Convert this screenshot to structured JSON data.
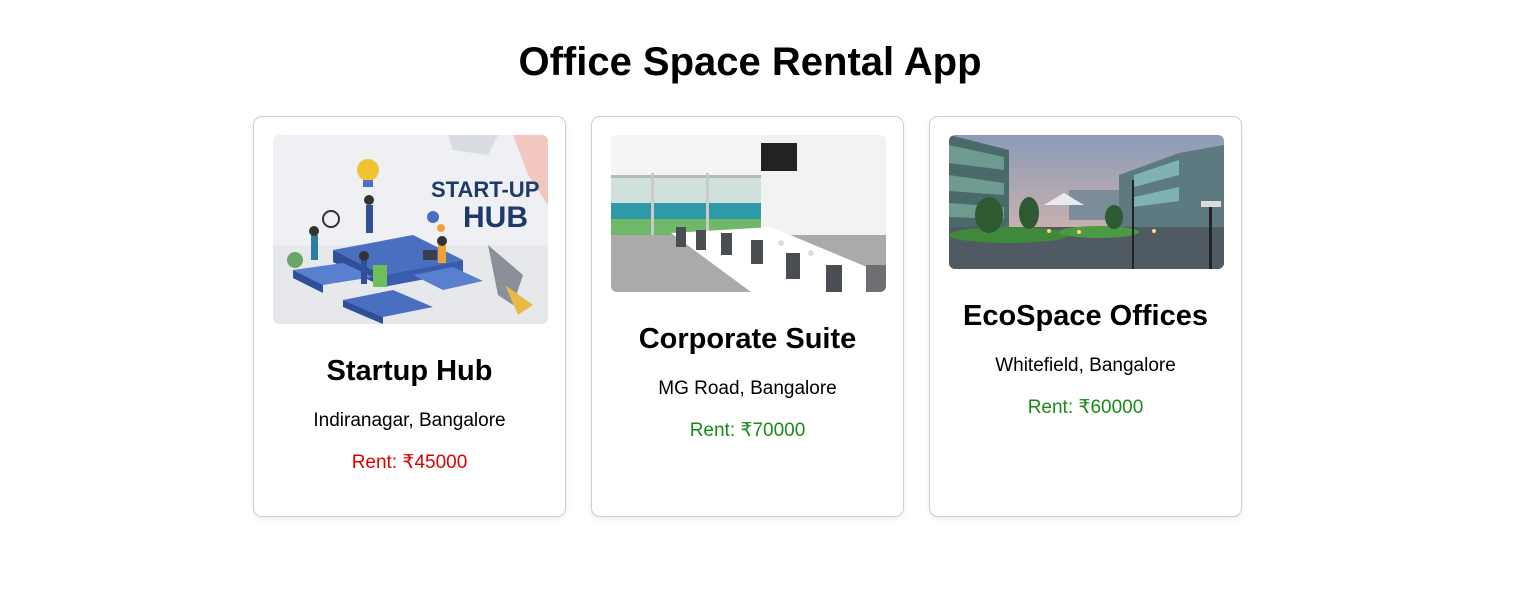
{
  "page": {
    "title": "Office Space Rental App"
  },
  "offices": [
    {
      "name": "Startup Hub",
      "location": "Indiranagar, Bangalore",
      "rent": "Rent: ₹45000",
      "rent_color": "#e00000",
      "image_text_line1": "START-UP",
      "image_text_line2": "HUB",
      "image_icon": "startup-hub-illustration"
    },
    {
      "name": "Corporate Suite",
      "location": "MG Road, Bangalore",
      "rent": "Rent: ₹70000",
      "rent_color": "#1a8a1a",
      "image_icon": "conference-room-photo"
    },
    {
      "name": "EcoSpace Offices",
      "location": "Whitefield, Bangalore",
      "rent": "Rent: ₹60000",
      "rent_color": "#1a8a1a",
      "image_icon": "office-campus-photo"
    }
  ]
}
